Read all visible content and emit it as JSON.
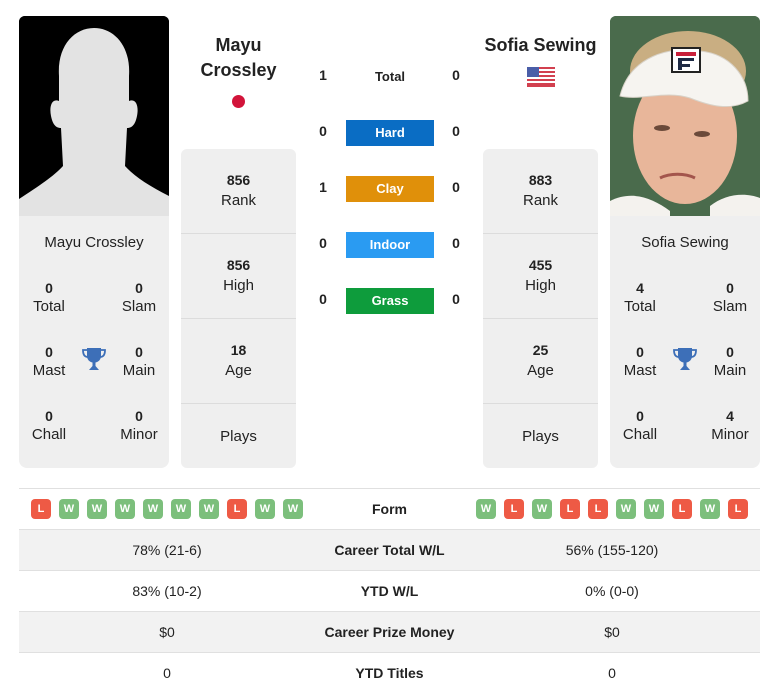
{
  "colors": {
    "hard": "#0a6dc4",
    "clay": "#e0900a",
    "indoor": "#2a9bf2",
    "grass": "#0e9c3c",
    "win": "#7cbf7c",
    "loss": "#ee5a45",
    "trophy": "#3d6fb8"
  },
  "player1": {
    "header_name_line1": "Mayu",
    "header_name_line2": "Crossley",
    "country_flag": "japan-flag",
    "card_name": "Mayu Crossley",
    "titles": {
      "total": "0",
      "total_label": "Total",
      "slam": "0",
      "slam_label": "Slam",
      "mast": "0",
      "mast_label": "Mast",
      "main": "0",
      "main_label": "Main",
      "chall": "0",
      "chall_label": "Chall",
      "minor": "0",
      "minor_label": "Minor"
    },
    "rank": "856",
    "rank_label": "Rank",
    "high": "856",
    "high_label": "High",
    "age": "18",
    "age_label": "Age",
    "plays_label": "Plays"
  },
  "player2": {
    "header_name": "Sofia Sewing",
    "country_flag": "usa-flag",
    "card_name": "Sofia Sewing",
    "titles": {
      "total": "4",
      "total_label": "Total",
      "slam": "0",
      "slam_label": "Slam",
      "mast": "0",
      "mast_label": "Mast",
      "main": "0",
      "main_label": "Main",
      "chall": "0",
      "chall_label": "Chall",
      "minor": "4",
      "minor_label": "Minor"
    },
    "rank": "883",
    "rank_label": "Rank",
    "high": "455",
    "high_label": "High",
    "age": "25",
    "age_label": "Age",
    "plays_label": "Plays"
  },
  "h2h": {
    "total": {
      "label": "Total",
      "p1": "1",
      "p2": "0"
    },
    "hard": {
      "label": "Hard",
      "p1": "0",
      "p2": "0"
    },
    "clay": {
      "label": "Clay",
      "p1": "1",
      "p2": "0"
    },
    "indoor": {
      "label": "Indoor",
      "p1": "0",
      "p2": "0"
    },
    "grass": {
      "label": "Grass",
      "p1": "0",
      "p2": "0"
    }
  },
  "table": {
    "form_label": "Form",
    "p1_form": [
      "L",
      "W",
      "W",
      "W",
      "W",
      "W",
      "W",
      "L",
      "W",
      "W"
    ],
    "p2_form": [
      "W",
      "L",
      "W",
      "L",
      "L",
      "W",
      "W",
      "L",
      "W",
      "L"
    ],
    "rows": [
      {
        "label": "Career Total W/L",
        "p1": "78% (21-6)",
        "p2": "56% (155-120)"
      },
      {
        "label": "YTD W/L",
        "p1": "83% (10-2)",
        "p2": "0% (0-0)"
      },
      {
        "label": "Career Prize Money",
        "p1": "$0",
        "p2": "$0"
      },
      {
        "label": "YTD Titles",
        "p1": "0",
        "p2": "0"
      }
    ]
  }
}
